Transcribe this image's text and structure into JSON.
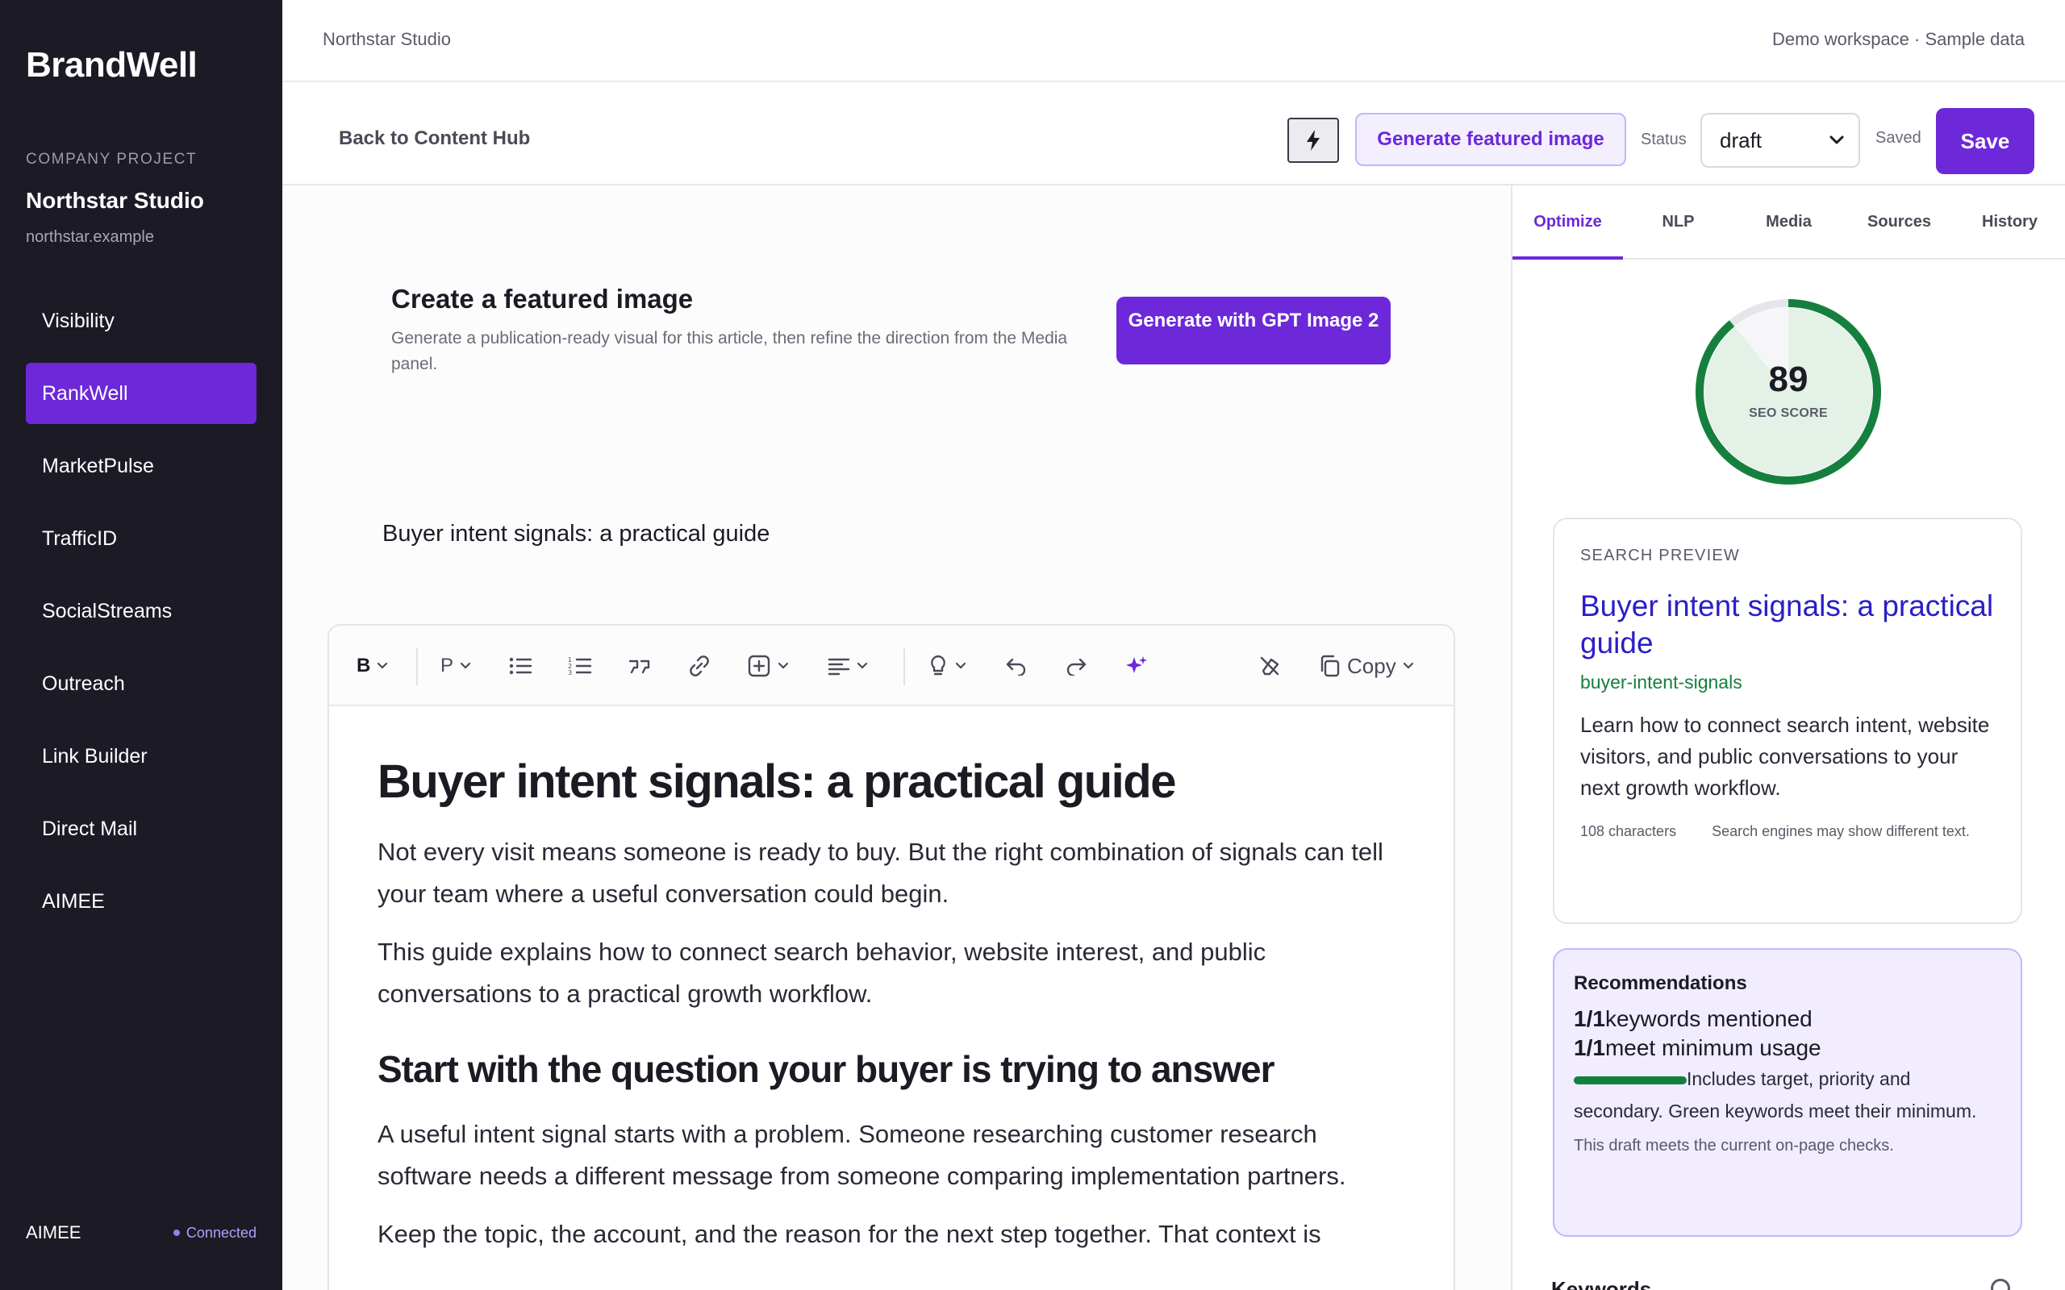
{
  "sidebar": {
    "brand": "BrandWell",
    "project_label": "COMPANY PROJECT",
    "project_name": "Northstar Studio",
    "project_domain": "northstar.example",
    "items": [
      {
        "label": "Visibility"
      },
      {
        "label": "RankWell",
        "active": true
      },
      {
        "label": "MarketPulse"
      },
      {
        "label": "TrafficID"
      },
      {
        "label": "SocialStreams"
      },
      {
        "label": "Outreach"
      },
      {
        "label": "Link Builder"
      },
      {
        "label": "Direct Mail"
      },
      {
        "label": "AIMEE"
      }
    ],
    "footer_name": "AIMEE",
    "footer_status": "Connected"
  },
  "topbar": {
    "workspace_name": "Northstar Studio",
    "workspace_note": "Demo workspace · Sample data"
  },
  "toolbar": {
    "back_label": "Back to Content Hub",
    "bolt_icon": "lightning-icon",
    "generate_image_label": "Generate featured image",
    "status_label": "Status",
    "status_value": "draft",
    "saved_label": "Saved",
    "save_label": "Save"
  },
  "featured": {
    "title": "Create a featured image",
    "description": "Generate a publication-ready visual for this article, then refine the direction from the Media panel.",
    "button_label": "Generate with GPT Image 2"
  },
  "article": {
    "title_field": "Buyer intent signals: a practical guide",
    "h1": "Buyer intent signals: a practical guide",
    "p1": "Not every visit means someone is ready to buy. But the right combination of signals can tell your team where a useful conversation could begin.",
    "p2": "This guide explains how to connect search behavior, website interest, and public conversations to a practical growth workflow.",
    "h2": "Start with the question your buyer is trying to answer",
    "p3": "A useful intent signal starts with a problem. Someone researching customer research software needs a different message from someone comparing implementation partners.",
    "p4": "Keep the topic, the account, and the reason for the next step together. That context is"
  },
  "editor_tools": {
    "bold": "B",
    "paragraph": "P",
    "copy_label": "Copy"
  },
  "panel": {
    "tabs": [
      "Optimize",
      "NLP",
      "Media",
      "Sources",
      "History"
    ],
    "active_tab": "Optimize",
    "score": {
      "value": "89",
      "label": "SEO SCORE",
      "fraction": 0.89,
      "color": "#15803d"
    },
    "preview": {
      "label": "SEARCH PREVIEW",
      "title": "Buyer intent signals: a practical guide",
      "url": "buyer-intent-signals",
      "description": "Learn how to connect search intent, website visitors, and public conversations to your next growth workflow.",
      "char_count": "108 characters",
      "note": "Search engines may show different text."
    },
    "recommendations": {
      "title": "Recommendations",
      "line1_count": "1/1",
      "line1_text": "keywords mentioned",
      "line2_count": "1/1",
      "line2_text": "meet minimum usage",
      "note": "Includes target, priority and secondary. Green keywords meet their minimum.",
      "footer": "This draft meets the current on-page checks."
    },
    "keywords_peek": "Keywords"
  },
  "colors": {
    "accent": "#6d28d9",
    "sidebar_bg": "#1b1a25",
    "success": "#15803d",
    "link": "#2b1ec6"
  }
}
